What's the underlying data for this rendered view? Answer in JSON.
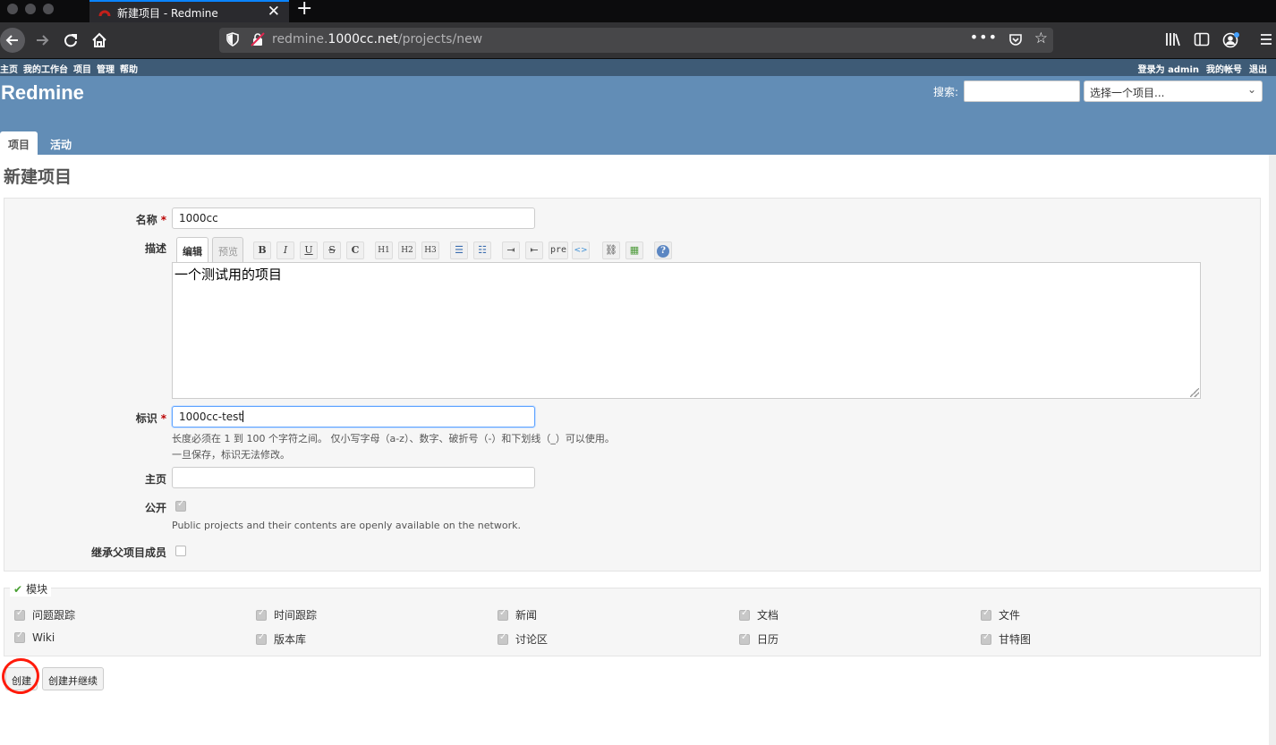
{
  "browser": {
    "tab_title": "新建项目 - Redmine",
    "close_glyph": "✕",
    "newtab_glyph": "+",
    "url_host": "redmine.",
    "url_domain": "1000cc.net",
    "url_path": "/projects/new",
    "page_actions_glyph": "•••"
  },
  "topmenu": {
    "items": [
      "主页",
      "我的工作台",
      "项目",
      "管理",
      "帮助"
    ],
    "logged_in_as": "登录为",
    "user": "admin",
    "my_account": "我的帐号",
    "logout": "退出"
  },
  "header": {
    "logo": "Redmine",
    "search_label": "搜索:",
    "search_placeholder": "",
    "project_jump": "选择一个项目..."
  },
  "mainmenu": {
    "projects": "项目",
    "activity": "活动"
  },
  "page": {
    "title": "新建项目",
    "fields": {
      "name_label": "名称",
      "name_value": "1000cc",
      "required_mark": "*",
      "description_label": "描述",
      "editor_tab_edit": "编辑",
      "editor_tab_preview": "预览",
      "toolbar": [
        "B",
        "I",
        "U",
        "S",
        "C",
        "H1",
        "H2",
        "H3",
        "ul",
        "ol",
        "indent-in",
        "indent-out",
        "pre",
        "code",
        "link",
        "image",
        "help"
      ],
      "toolbar_glyphs": {
        "B": "B",
        "I": "I",
        "U": "U",
        "S": "S",
        "C": "C",
        "H1": "H1",
        "H2": "H2",
        "H3": "H3",
        "ul": "☰",
        "ol": "☷",
        "indent-in": "⇥",
        "indent-out": "⇤",
        "pre": "pre",
        "code": "<>",
        "link": "⛓",
        "image": "▦",
        "help": "?"
      },
      "description_value": "一个测试用的项目",
      "identifier_label": "标识",
      "identifier_value": "1000cc-test",
      "identifier_hint1": "长度必须在 1 到 100 个字符之间。 仅小写字母（a-z）、数字、破折号（-）和下划线（_）可以使用。",
      "identifier_hint2": "一旦保存，标识无法修改。",
      "homepage_label": "主页",
      "homepage_value": "",
      "public_label": "公开",
      "public_checked": true,
      "public_hint": "Public projects and their contents are openly available on the network.",
      "inherit_label": "继承父项目成员",
      "inherit_checked": false
    },
    "modules": {
      "legend": "模块",
      "legend_glyph": "✔",
      "items": [
        {
          "label": "问题跟踪",
          "checked": true
        },
        {
          "label": "时间跟踪",
          "checked": true
        },
        {
          "label": "新闻",
          "checked": true
        },
        {
          "label": "文档",
          "checked": true
        },
        {
          "label": "文件",
          "checked": true
        },
        {
          "label": "Wiki",
          "checked": true
        },
        {
          "label": "版本库",
          "checked": true
        },
        {
          "label": "讨论区",
          "checked": true
        },
        {
          "label": "日历",
          "checked": true
        },
        {
          "label": "甘特图",
          "checked": true
        }
      ]
    },
    "buttons": {
      "create": "创建",
      "create_continue": "创建并继续"
    }
  },
  "colors": {
    "header_bg": "#628db6",
    "topmenu_bg": "#3e5b76",
    "required": "#bb0000",
    "annotation": "#ff1a0a"
  }
}
